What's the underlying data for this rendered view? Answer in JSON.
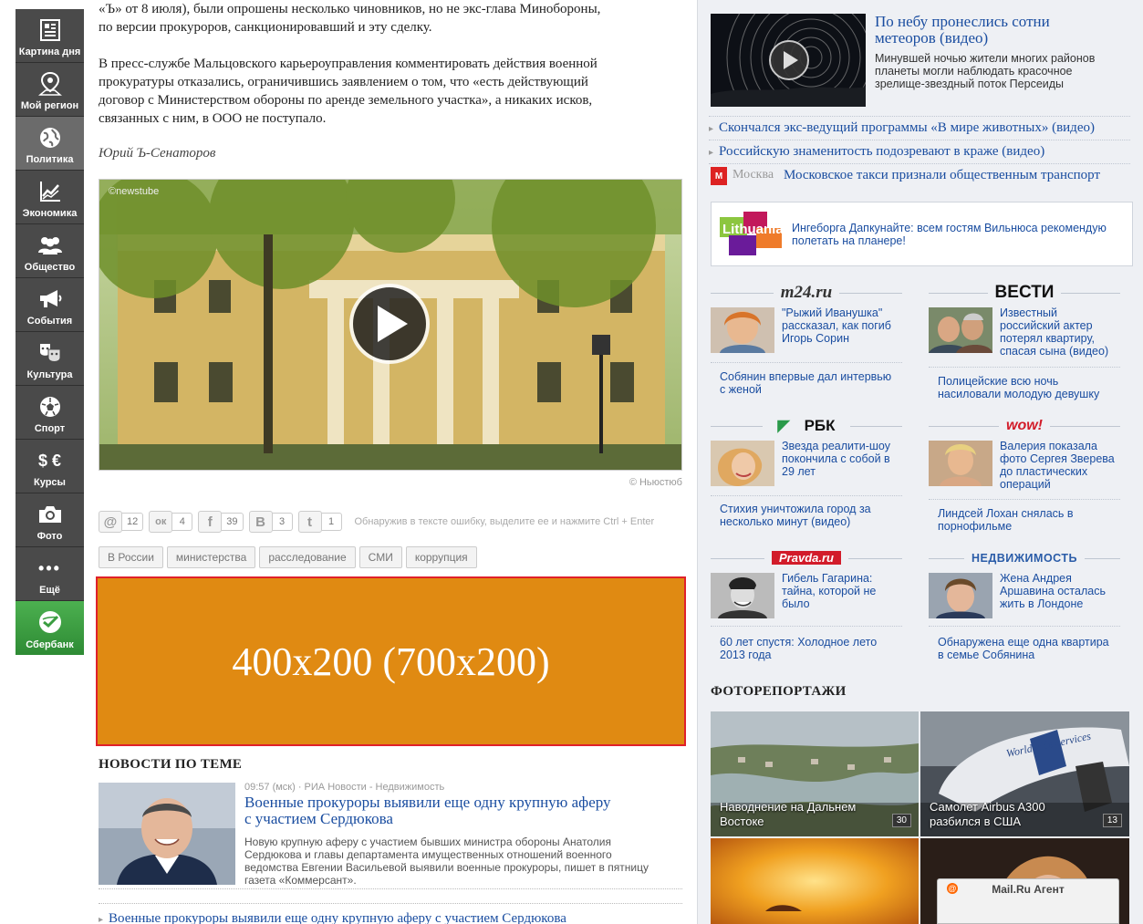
{
  "sidebar": {
    "items": [
      {
        "label": "Картина дня",
        "icon": "newspaper-icon"
      },
      {
        "label": "Мой регион",
        "icon": "map-pin-icon"
      },
      {
        "label": "Политика",
        "icon": "globe-icon"
      },
      {
        "label": "Экономика",
        "icon": "chart-icon"
      },
      {
        "label": "Общество",
        "icon": "people-icon"
      },
      {
        "label": "События",
        "icon": "megaphone-icon"
      },
      {
        "label": "Культура",
        "icon": "masks-icon"
      },
      {
        "label": "Спорт",
        "icon": "ball-icon"
      },
      {
        "label": "Курсы",
        "icon": "currency-icon",
        "glyph": "$ €"
      },
      {
        "label": "Фото",
        "icon": "camera-icon"
      },
      {
        "label": "Ещё",
        "icon": "more-icon",
        "glyph": "•••"
      },
      {
        "label": "Сбербанк",
        "icon": "sberbank-logo-icon"
      }
    ]
  },
  "article": {
    "para1_line1": "«Ъ» от 8 июля), были опрошены несколько чиновников, но не экс-глава Минобороны,",
    "para1_line2": "по версии прокуроров, санкционировавший и эту сделку.",
    "para2_line1": "В пресс-службе Мальцовского карьероуправления комментировать действия военной",
    "para2_line2": "прокуратуры отказались, ограничившись заявлением о том, что «есть действующий",
    "para2_line3": "договор с Министерством обороны по аренде земельного участка», а никаких исков,",
    "para2_line4": "связанных с ним, в ООО не поступало.",
    "author": "Юрий Ъ-Сенаторов",
    "video_watermark": "©newstube",
    "video_copyright": "© Ньюстюб"
  },
  "share": {
    "buttons": [
      {
        "icon": "mailru-icon",
        "glyph": "@",
        "count": "12"
      },
      {
        "icon": "odnoklassniki-icon",
        "glyph": "ок",
        "count": "4"
      },
      {
        "icon": "facebook-icon",
        "glyph": "f",
        "count": "39"
      },
      {
        "icon": "vkontakte-icon",
        "glyph": "B",
        "count": "3"
      },
      {
        "icon": "twitter-icon",
        "glyph": "t",
        "count": "1"
      }
    ],
    "error_note": "Обнаружив в тексте ошибку, выделите ее и нажмите Ctrl + Enter"
  },
  "tags": [
    "В России",
    "министерства",
    "расследование",
    "СМИ",
    "коррупция"
  ],
  "ad_text": "400x200 (700x200)",
  "related": {
    "title": "НОВОСТИ ПО ТЕМЕ",
    "meta": "09:57 (мск)  ·  РИА Новости - Недвижимость",
    "headline_line1": "Военные прокуроры выявили еще одну крупную аферу",
    "headline_line2": "с участием Сердюкова",
    "summary_line1": "Новую крупную аферу с участием бывших министра обороны Анатолия",
    "summary_line2": "Сердюкова и главы департамента имущественных отношений военного",
    "summary_line3": "ведомства Евгении Васильевой выявили военные прокуроры, пишет в пятницу",
    "summary_line4": "газета «Коммерсант».",
    "bottom_link": "Военные прокуроры выявили еще одну крупную аферу с участием Сердюкова"
  },
  "right": {
    "top_story": {
      "title_line1": "По небу пронеслись сотни",
      "title_line2": "метеоров (видео)",
      "desc_line1": "Минувшей ночью жители многих районов",
      "desc_line2": "планеты могли наблюдать красочное",
      "desc_line3": "зрелище-звездный поток Персеиды"
    },
    "links": [
      "Скончался экс-ведущий программы «В мире животных» (видео)",
      "Российскую знаменитость подозревают в краже (видео)"
    ],
    "moscow_label": "Москва",
    "moscow_link": "Московское такси признали общественным транспорт",
    "lithuania": {
      "logo_text": "Lithuania",
      "text_line1": "Ингеборга Дапкунайте: всем гостям Вильнюса рекомендую",
      "text_line2": "полетать на планере!"
    },
    "partners": [
      {
        "name": "m24.ru",
        "story_lines": [
          "\"Рыжий Иванушка\"",
          "рассказал, как погиб",
          "Игорь Сорин"
        ],
        "link_lines": [
          "Собянин впервые дал интервью",
          "с женой"
        ]
      },
      {
        "name": "ВЕСТИ",
        "story_lines": [
          "Известный",
          "российский актер",
          "потерял квартиру,",
          "спасая сына (видео)"
        ],
        "link_lines": [
          "Полицейские всю ночь",
          "насиловали молодую девушку"
        ]
      },
      {
        "name": "РБК",
        "story_lines": [
          "Звезда реалити-шоу",
          "покончила с собой в",
          "29 лет"
        ],
        "link_lines": [
          "Стихия уничтожила город за",
          "несколько минут (видео)"
        ]
      },
      {
        "name": "wow!",
        "story_lines": [
          "Валерия показала",
          "фото Сергея Зверева",
          "до пластических",
          "операций"
        ],
        "link_lines": [
          "Линдсей Лохан снялась в",
          "порнофильме"
        ]
      },
      {
        "name": "Pravda.ru",
        "story_lines": [
          "Гибель Гагарина:",
          "тайна, которой не",
          "было"
        ],
        "link_lines": [
          "60 лет спустя: Холодное лето",
          "2013 года"
        ]
      },
      {
        "name": "НЕДВИЖИМОСТЬ",
        "story_lines": [
          "Жена Андрея",
          "Аршавина осталась",
          "жить в Лондоне"
        ],
        "link_lines": [
          "Обнаружена еще одна квартира",
          "в семье Собянина"
        ]
      }
    ],
    "photo_title": "ФОТОРЕПОРТАЖИ",
    "photos": [
      {
        "caption_line1": "Наводнение на Дальнем",
        "caption_line2": "Востоке",
        "count": "30"
      },
      {
        "caption_line1": "Самолет Airbus A300",
        "caption_line2": "разбился в США",
        "count": "13"
      }
    ],
    "plane_text": "Worldwide Services",
    "agent_label": "Mail.Ru Агент"
  },
  "colors": {
    "link": "#1a4da0",
    "ad_orange": "#e08a12",
    "ad_border": "#e0202a",
    "sidebar_bg": "#4a4a4a",
    "sidebar_active": "#6b6b6b",
    "sberbank_green": "#3a9d40"
  }
}
